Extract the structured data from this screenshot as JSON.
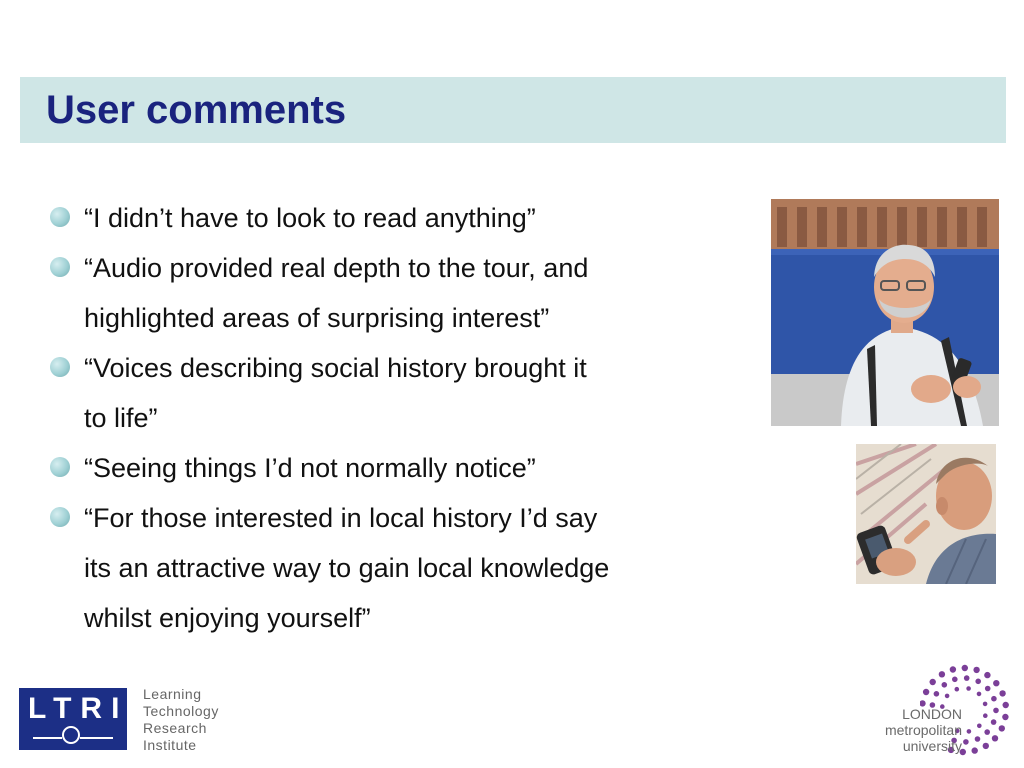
{
  "slide": {
    "title": "User comments",
    "bullets": [
      {
        "lines": [
          "“I didn’t have to look to read anything”"
        ]
      },
      {
        "lines": [
          "“Audio provided real depth to the tour, and",
          "highlighted areas of surprising interest”"
        ]
      },
      {
        "lines": [
          "“Voices describing social history brought it",
          "to life”"
        ]
      },
      {
        "lines": [
          "“Seeing things I’d not normally notice”"
        ]
      },
      {
        "lines": [
          "“For those interested in local history I’d say",
          "its an attractive way to gain local knowledge",
          "whilst enjoying yourself”"
        ]
      }
    ]
  },
  "logos": {
    "ltri": {
      "letters": "LTRI",
      "name_lines": [
        "Learning",
        "Technology",
        "Research",
        "Institute"
      ]
    },
    "lmu": {
      "lines": [
        "LONDON",
        "metropolitan",
        "university"
      ],
      "dot_color": "#7b3f98"
    }
  },
  "colors": {
    "title_text": "#1a237e",
    "title_band": "#cfe6e6",
    "bullet": "#9fd0d4"
  }
}
